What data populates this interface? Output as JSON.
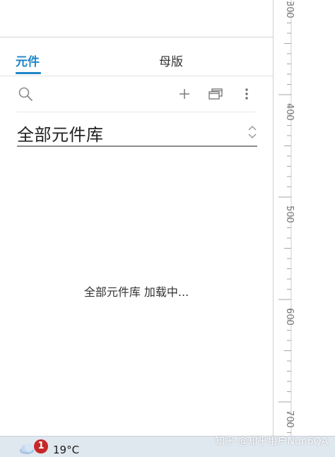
{
  "tabs": {
    "components_label": "元件",
    "masters_label": "母版"
  },
  "toolbar": {
    "search_icon": "search-icon",
    "add_icon": "plus-icon",
    "copy_icon": "copy-windows-icon",
    "more_icon": "more-vertical-icon"
  },
  "library": {
    "selected": "全部元件库"
  },
  "status": {
    "loading_text": "全部元件库 加载中..."
  },
  "ruler": {
    "labels": [
      "300",
      "400",
      "500",
      "600",
      "700"
    ]
  },
  "taskbar": {
    "notification_count": "1",
    "temperature": "19°C"
  },
  "watermark": {
    "text": "知乎 @知乎用户Nun6QA"
  },
  "colors": {
    "accent": "#1f86c8",
    "badge": "#c62828",
    "taskbar": "#dfe7ef"
  }
}
